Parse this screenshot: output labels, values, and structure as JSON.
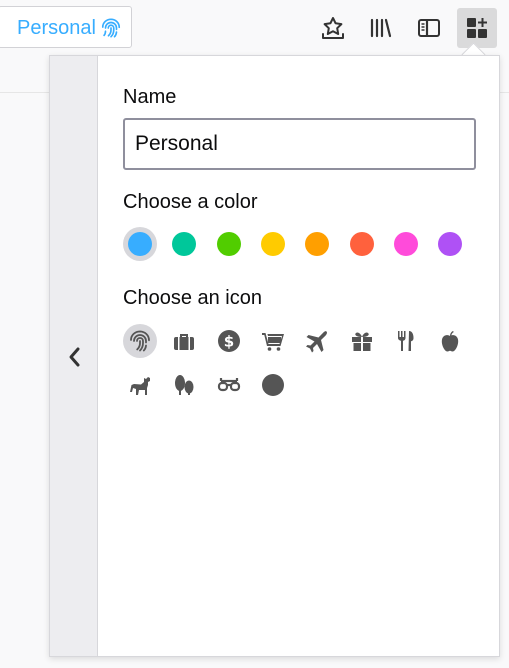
{
  "toolbar": {
    "container_name": "Personal",
    "container_color": "#37adff"
  },
  "panel": {
    "name_label": "Name",
    "name_value": "Personal",
    "color_label": "Choose a color",
    "icon_label": "Choose an icon",
    "colors": [
      {
        "name": "blue",
        "hex": "#37adff",
        "selected": true
      },
      {
        "name": "turquoise",
        "hex": "#00c79a",
        "selected": false
      },
      {
        "name": "green",
        "hex": "#51cd00",
        "selected": false
      },
      {
        "name": "yellow",
        "hex": "#ffcb00",
        "selected": false
      },
      {
        "name": "orange",
        "hex": "#ff9f00",
        "selected": false
      },
      {
        "name": "red",
        "hex": "#ff613d",
        "selected": false
      },
      {
        "name": "pink",
        "hex": "#ff4bda",
        "selected": false
      },
      {
        "name": "purple",
        "hex": "#af51f5",
        "selected": false
      }
    ],
    "icons": [
      {
        "name": "fingerprint-icon",
        "selected": true
      },
      {
        "name": "briefcase-icon",
        "selected": false
      },
      {
        "name": "dollar-icon",
        "selected": false
      },
      {
        "name": "cart-icon",
        "selected": false
      },
      {
        "name": "vacation-icon",
        "selected": false
      },
      {
        "name": "gift-icon",
        "selected": false
      },
      {
        "name": "food-icon",
        "selected": false
      },
      {
        "name": "fruit-icon",
        "selected": false
      },
      {
        "name": "pet-icon",
        "selected": false
      },
      {
        "name": "tree-icon",
        "selected": false
      },
      {
        "name": "chill-icon",
        "selected": false
      },
      {
        "name": "circle-icon",
        "selected": false
      }
    ]
  }
}
